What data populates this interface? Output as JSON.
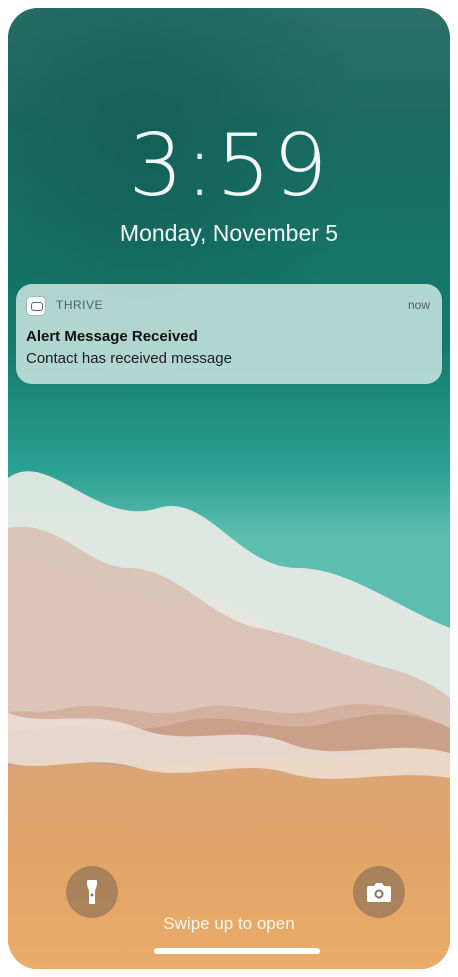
{
  "lockscreen": {
    "time": "3:59",
    "date": "Monday, November 5",
    "swipe_hint": "Swipe up to open"
  },
  "notification": {
    "app_name": "THRIVE",
    "time": "now",
    "title": "Alert Message Received",
    "body": "Contact has received message"
  },
  "icons": {
    "app": "thrive-app-icon",
    "flashlight": "flashlight-icon",
    "camera": "camera-icon"
  },
  "colors": {
    "sea_deep": "#0f5b52",
    "sea_teal": "#2d9c8f",
    "foam": "#e9eae6",
    "sand": "#e2a566"
  }
}
